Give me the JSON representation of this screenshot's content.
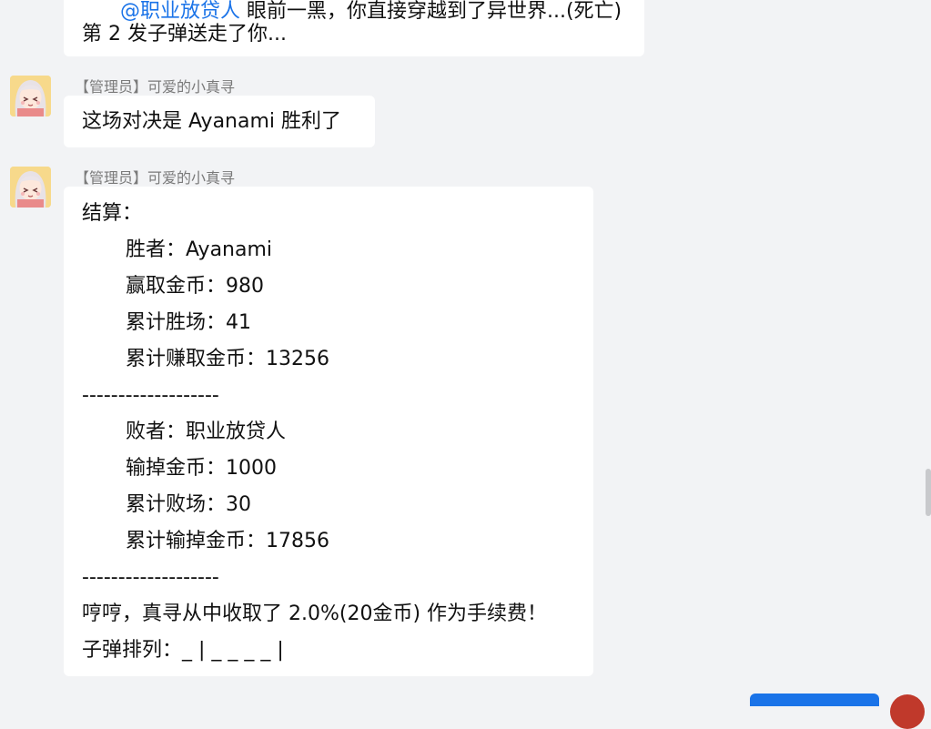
{
  "messages": [
    {
      "line1_mention": "@职业放贷人",
      "line1_rest": " 眼前一黑，你直接穿越到了异世界...(死亡)",
      "line2": "第 2 发子弹送走了你..."
    },
    {
      "sender": "【管理员】可爱的小真寻",
      "text": "这场对决是 Ayanami 胜利了"
    },
    {
      "sender": "【管理员】可爱的小真寻",
      "title": "结算：",
      "winner": "胜者：Ayanami",
      "win_coins": "赢取金币：980",
      "total_wins": "累计胜场：41",
      "total_earned": "累计赚取金币：13256",
      "divider1": "-------------------",
      "loser": "败者：职业放贷人",
      "lose_coins": "输掉金币：1000",
      "total_losses": "累计败场：30",
      "total_lost": "累计输掉金币：17856",
      "divider2": "-------------------",
      "fee": "哼哼，真寻从中收取了 2.0%(20金币) 作为手续费！",
      "bullets": "子弹排列：_ | _ _ _ _ |"
    }
  ]
}
